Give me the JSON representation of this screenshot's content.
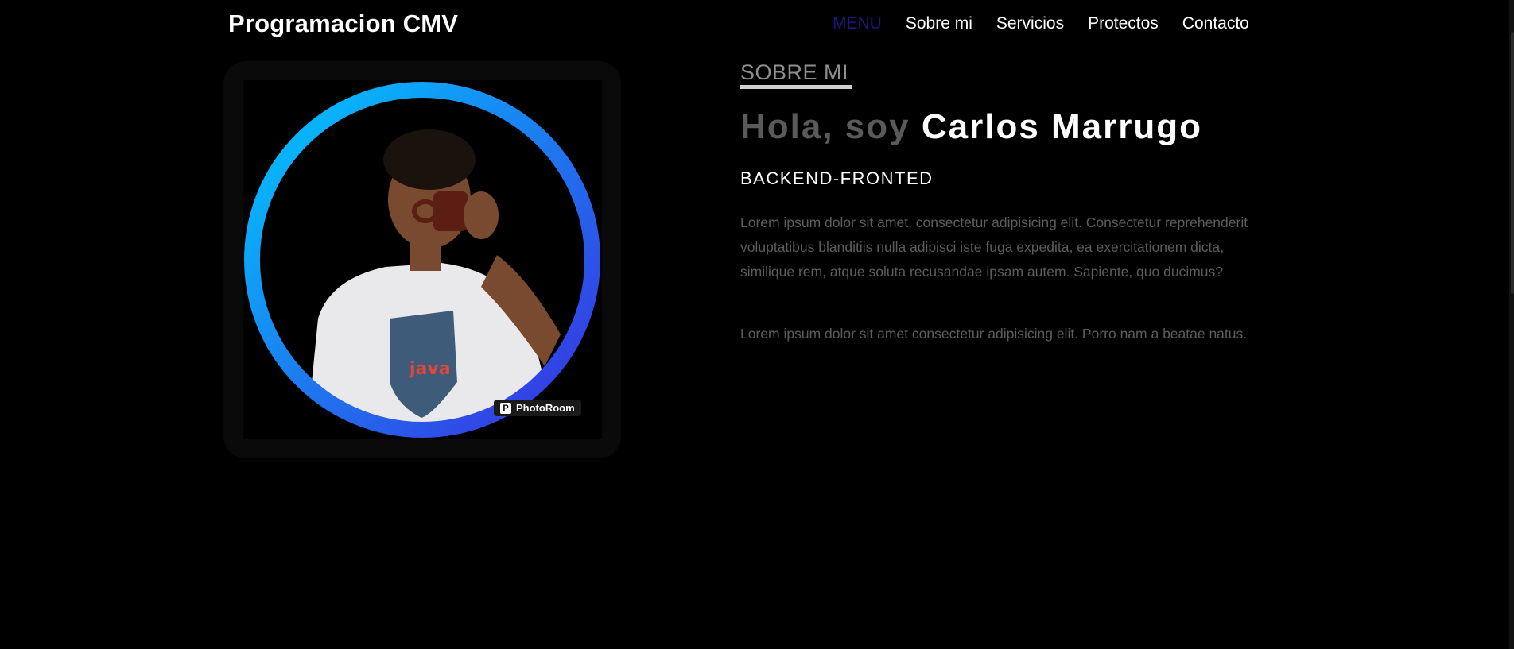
{
  "header": {
    "brand": "Programacion CMV",
    "nav": [
      {
        "label": "MENU"
      },
      {
        "label": "Sobre mi"
      },
      {
        "label": "Servicios"
      },
      {
        "label": "Protectos"
      },
      {
        "label": "Contacto"
      }
    ]
  },
  "photo": {
    "badge_icon": "photoroom-logo-icon",
    "badge_text": "PhotoRoom",
    "ring_colors": [
      "#00c8ff",
      "#3a2de0"
    ]
  },
  "about": {
    "section_label": "SOBRE MI",
    "greeting_pre": "Hola, soy ",
    "greeting_name": "Carlos Marrugo",
    "role": "BACKEND-FRONTED",
    "paragraph1": "Lorem ipsum dolor sit amet, consectetur adipisicing elit. Consectetur reprehenderit voluptatibus blanditiis nulla adipisci iste fuga expedita, ea exercitationem dicta, similique rem, atque soluta recusandae ipsam autem. Sapiente, quo ducimus?",
    "paragraph2": "Lorem ipsum dolor sit amet consectetur adipisicing elit. Porro nam a beatae natus."
  },
  "colors": {
    "background": "#000000",
    "menu_active": "#1c1680",
    "muted_text": "#5c5c5c"
  }
}
